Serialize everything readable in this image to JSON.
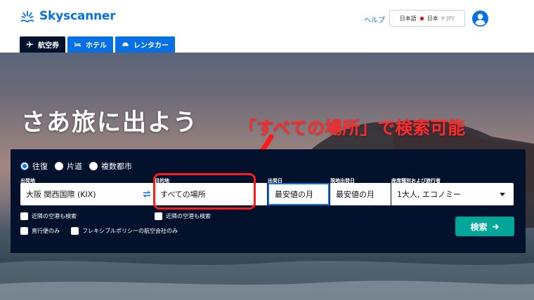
{
  "brand": {
    "name": "Skyscanner",
    "color": "#0770e3"
  },
  "header": {
    "help_label": "ヘルプ",
    "locale_language": "日本語",
    "locale_country": "日本",
    "locale_currency": "¥ JPY"
  },
  "tabs": [
    {
      "label": "航空券",
      "icon": "plane-icon",
      "active": true
    },
    {
      "label": "ホテル",
      "icon": "bed-icon",
      "active": false
    },
    {
      "label": "レンタカー",
      "icon": "car-icon",
      "active": false
    }
  ],
  "hero": {
    "title": "さあ旅に出よう",
    "annotation": "「すべての場所」で検索可能"
  },
  "search": {
    "trip_types": [
      "往復",
      "片道",
      "複数都市"
    ],
    "selected_trip_type": "往復",
    "origin_label": "出発地",
    "origin_value": "大阪 関西国際 (KIX)",
    "destination_label": "目的地",
    "destination_value": "すべての場所",
    "depart_label": "出発日",
    "depart_value": "最安値の月",
    "return_label": "現地出発日",
    "return_value": "最安値の月",
    "travellers_label": "座席種別および旅行者",
    "travellers_value": "1大人, エコノミー",
    "nearby_origin_label": "近隣の空港も検索",
    "nearby_dest_label": "近隣の空港も検索",
    "direct_label": "直行便のみ",
    "flexible_label": "フレキシブルポリシーの航空会社のみ",
    "search_button": "検索"
  },
  "colors": {
    "dark_navy": "#02122c",
    "search_green": "#00a698",
    "annotation_red": "#ff2a2a"
  }
}
